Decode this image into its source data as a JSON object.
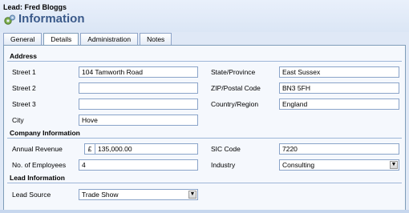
{
  "header": {
    "breadcrumb": "Lead: Fred Bloggs",
    "title": "Information",
    "title_icon": "form-gear-icon"
  },
  "tabs": [
    {
      "label": "General",
      "active": false
    },
    {
      "label": "Details",
      "active": true
    },
    {
      "label": "Administration",
      "active": false
    },
    {
      "label": "Notes",
      "active": false
    }
  ],
  "address": {
    "heading": "Address",
    "street1_label": "Street 1",
    "street1_value": "104 Tamworth Road",
    "street2_label": "Street 2",
    "street2_value": "",
    "street3_label": "Street 3",
    "street3_value": "",
    "city_label": "City",
    "city_value": "Hove",
    "state_label": "State/Province",
    "state_value": "East Sussex",
    "zip_label": "ZIP/Postal Code",
    "zip_value": "BN3 5FH",
    "country_label": "Country/Region",
    "country_value": "England"
  },
  "company": {
    "heading": "Company Information",
    "revenue_label": "Annual Revenue",
    "currency_symbol": "£",
    "revenue_value": "135,000.00",
    "employees_label": "No. of Employees",
    "employees_value": "4",
    "sic_label": "SIC Code",
    "sic_value": "7220",
    "industry_label": "Industry",
    "industry_value": "Consulting"
  },
  "lead": {
    "heading": "Lead Information",
    "source_label": "Lead Source",
    "source_value": "Trade Show"
  },
  "colors": {
    "title": "#3b5a8a",
    "background": "#dfe8f6",
    "panel": "#f5f8fd",
    "field_border": "#8aa4c9"
  }
}
